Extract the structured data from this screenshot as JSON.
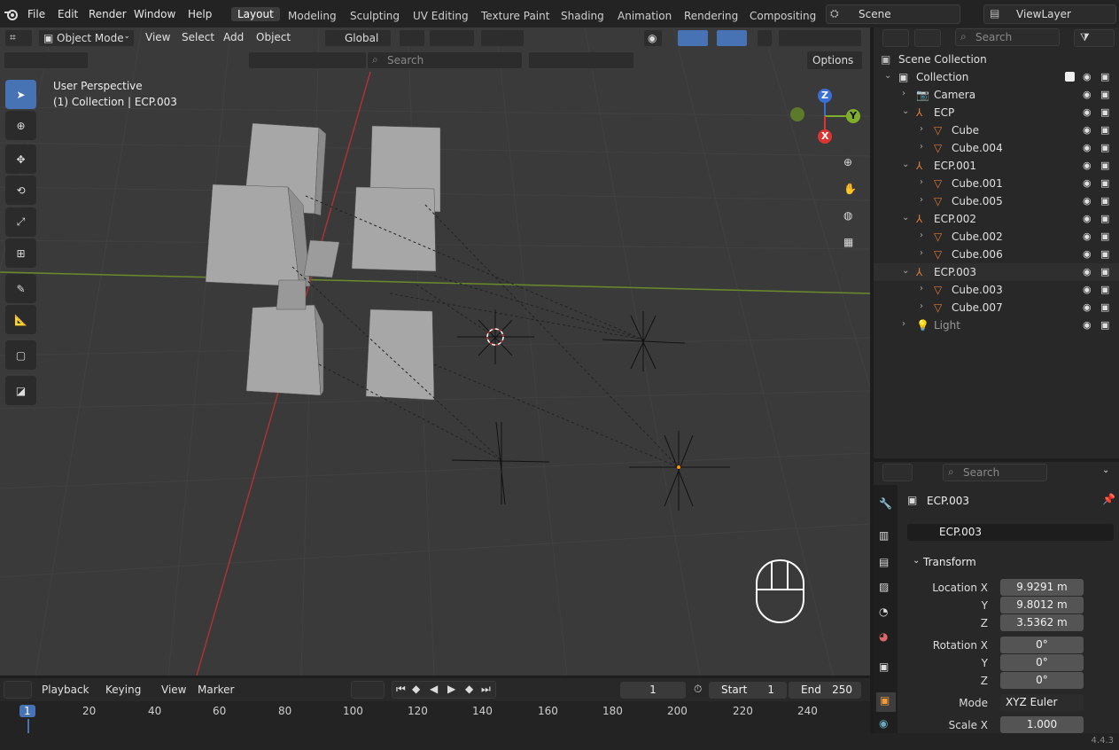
{
  "menus": [
    "File",
    "Edit",
    "Render",
    "Window",
    "Help"
  ],
  "workspaces": [
    "Layout",
    "Modeling",
    "Sculpting",
    "UV Editing",
    "Texture Paint",
    "Shading",
    "Animation",
    "Rendering",
    "Compositing"
  ],
  "scene_name": "Scene",
  "view_layer": "ViewLayer",
  "viewport": {
    "mode": "Object Mode",
    "menus": [
      "View",
      "Select",
      "Add",
      "Object"
    ],
    "transform_orientation": "Global",
    "search_placeholder": "Search",
    "options_label": "Options",
    "perspective_label": "User Perspective",
    "collection_label": "(1) Collection | ECP.003",
    "gizmo": {
      "x": "X",
      "y": "Y",
      "z": "Z"
    }
  },
  "outliner": {
    "search_placeholder": "Search",
    "rows": [
      {
        "label": "Scene Collection",
        "indent": 0,
        "kind": "scene"
      },
      {
        "label": "Collection",
        "indent": 1,
        "kind": "collection"
      },
      {
        "label": "Camera",
        "indent": 2,
        "kind": "camera"
      },
      {
        "label": "ECP",
        "indent": 2,
        "kind": "empty"
      },
      {
        "label": "Cube",
        "indent": 3,
        "kind": "mesh"
      },
      {
        "label": "Cube.004",
        "indent": 3,
        "kind": "mesh"
      },
      {
        "label": "ECP.001",
        "indent": 2,
        "kind": "empty"
      },
      {
        "label": "Cube.001",
        "indent": 3,
        "kind": "mesh"
      },
      {
        "label": "Cube.005",
        "indent": 3,
        "kind": "mesh"
      },
      {
        "label": "ECP.002",
        "indent": 2,
        "kind": "empty"
      },
      {
        "label": "Cube.002",
        "indent": 3,
        "kind": "mesh"
      },
      {
        "label": "Cube.006",
        "indent": 3,
        "kind": "mesh"
      },
      {
        "label": "ECP.003",
        "indent": 2,
        "kind": "empty"
      },
      {
        "label": "Cube.003",
        "indent": 3,
        "kind": "mesh"
      },
      {
        "label": "Cube.007",
        "indent": 3,
        "kind": "mesh"
      },
      {
        "label": "Light",
        "indent": 2,
        "kind": "light"
      }
    ]
  },
  "properties": {
    "search_placeholder": "Search",
    "object_name": "ECP.003",
    "object_field": "ECP.003",
    "panel_title": "Transform",
    "location_label": "Location X",
    "loc_x": "9.9291 m",
    "y_label": "Y",
    "loc_y": "9.8012 m",
    "z_label": "Z",
    "loc_z": "3.5362 m",
    "rotation_label": "Rotation X",
    "rot_x": "0°",
    "rot_y": "0°",
    "rot_z": "0°",
    "mode_label": "Mode",
    "mode_value": "XYZ Euler",
    "scale_label": "Scale X",
    "scale_x": "1.000"
  },
  "timeline": {
    "menus": [
      "Playback",
      "Keying",
      "View",
      "Marker"
    ],
    "current_frame": "1",
    "start_label": "Start",
    "start": "1",
    "end_label": "End",
    "end": "250",
    "ticks": [
      "1",
      "20",
      "40",
      "60",
      "80",
      "100",
      "120",
      "140",
      "160",
      "180",
      "200",
      "220",
      "240"
    ]
  },
  "version": "4.4.3"
}
